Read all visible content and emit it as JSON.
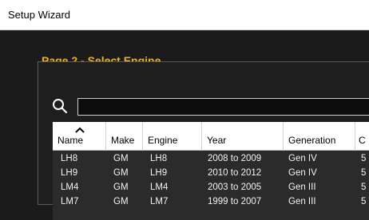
{
  "window": {
    "title": "Setup Wizard"
  },
  "page": {
    "title": "Page 2 - Select Engine"
  },
  "search": {
    "value": "",
    "placeholder": ""
  },
  "table": {
    "columns": [
      "Name",
      "Make",
      "Engine",
      "Year",
      "Generation",
      "C"
    ],
    "sorted_column": "Name",
    "rows": [
      [
        "LH8",
        "GM",
        "LH8",
        "2008 to 2009",
        "Gen IV",
        "5"
      ],
      [
        "LH9",
        "GM",
        "LH9",
        "2010 to 2012",
        "Gen IV",
        "5"
      ],
      [
        "LM4",
        "GM",
        "LM4",
        "2003 to 2005",
        "Gen III",
        "5"
      ],
      [
        "LM7",
        "GM",
        "LM7",
        "1999 to 2007",
        "Gen III",
        "5"
      ]
    ]
  },
  "colors": {
    "accent": "#f2b01e",
    "background": "#1b1b1b",
    "grid_bg": "#2b2b2b"
  }
}
